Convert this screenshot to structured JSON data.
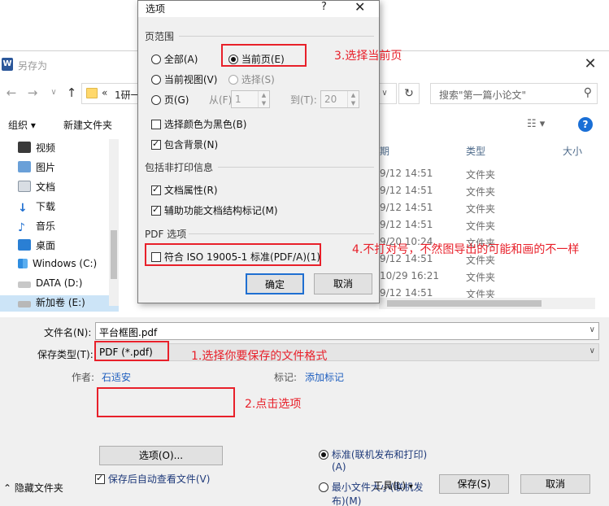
{
  "save_dialog": {
    "title": "另存为",
    "app_icon_letter": "W",
    "close": "✕",
    "address": {
      "separator": "«",
      "path": "1研一..."
    },
    "search_placeholder": "搜索\"第一篇小论文\"",
    "toolbar": {
      "organize": "组织 ▾",
      "new_folder": "新建文件夹"
    },
    "sidebar": [
      {
        "label": "视频"
      },
      {
        "label": "图片"
      },
      {
        "label": "文档"
      },
      {
        "label": "下载"
      },
      {
        "label": "音乐"
      },
      {
        "label": "桌面"
      },
      {
        "label": "Windows (C:)"
      },
      {
        "label": "DATA (D:)"
      },
      {
        "label": "新加卷 (E:)"
      }
    ],
    "columns": {
      "date": "期",
      "type": "类型",
      "size": "大小"
    },
    "files": [
      {
        "date": "9/12 14:51",
        "type": "文件夹"
      },
      {
        "date": "9/12 14:51",
        "type": "文件夹"
      },
      {
        "date": "9/12 14:51",
        "type": "文件夹"
      },
      {
        "date": "9/12 14:51",
        "type": "文件夹"
      },
      {
        "date": "9/20 10:24",
        "type": "文件夹"
      },
      {
        "date": "9/12 14:51",
        "type": "文件夹"
      },
      {
        "date": "10/29 16:21",
        "type": "文件夹"
      },
      {
        "date": "9/12 14:51",
        "type": "文件夹"
      }
    ],
    "filename_label": "文件名(N):",
    "filename_value": "平台框图.pdf",
    "filetype_label": "保存类型(T):",
    "filetype_value": "PDF (*.pdf)",
    "author_label": "作者:",
    "author_value": "石适安",
    "tags_label": "标记:",
    "tags_value": "添加标记",
    "options_button": "选项(O)...",
    "view_after_save": "保存后自动查看文件(V)",
    "optimize_standard_line1": "标准(联机发布和打印)",
    "optimize_standard_line2": "(A)",
    "optimize_min_line1": "最小文件大小(联机发",
    "optimize_min_line2": "布)(M)",
    "hide_folders": "隐藏文件夹",
    "tools": "工具(L)",
    "save": "保存(S)",
    "cancel": "取消"
  },
  "options_dialog": {
    "title": "选项",
    "help": "?",
    "close": "✕",
    "page_range_label": "页范围",
    "all": "全部(A)",
    "current_page": "当前页(E)",
    "current_view": "当前视图(V)",
    "selection": "选择(S)",
    "pages": "页(G)",
    "from_label": "从(F):",
    "from_value": "1",
    "to_label": "到(T):",
    "to_value": "20",
    "black_color": "选择颜色为黑色(B)",
    "include_bg": "包含背景(N)",
    "nonprint_label": "包括非打印信息",
    "doc_props": "文档属性(R)",
    "accessibility": "辅助功能文档结构标记(M)",
    "pdf_label": "PDF 选项",
    "iso": "符合 ISO 19005-1 标准(PDF/A)(1)",
    "ok": "确定",
    "cancel": "取消"
  },
  "annotations": {
    "a1": "1.选择你要保存的文件格式",
    "a2": "2.点击选项",
    "a3": "3.选择当前页",
    "a4": "4.不打对号，不然图导出的可能和画的不一样"
  },
  "colors": {
    "annotation": "#e8202a",
    "link": "#1f5fbf",
    "selected": "#cce4f7"
  }
}
